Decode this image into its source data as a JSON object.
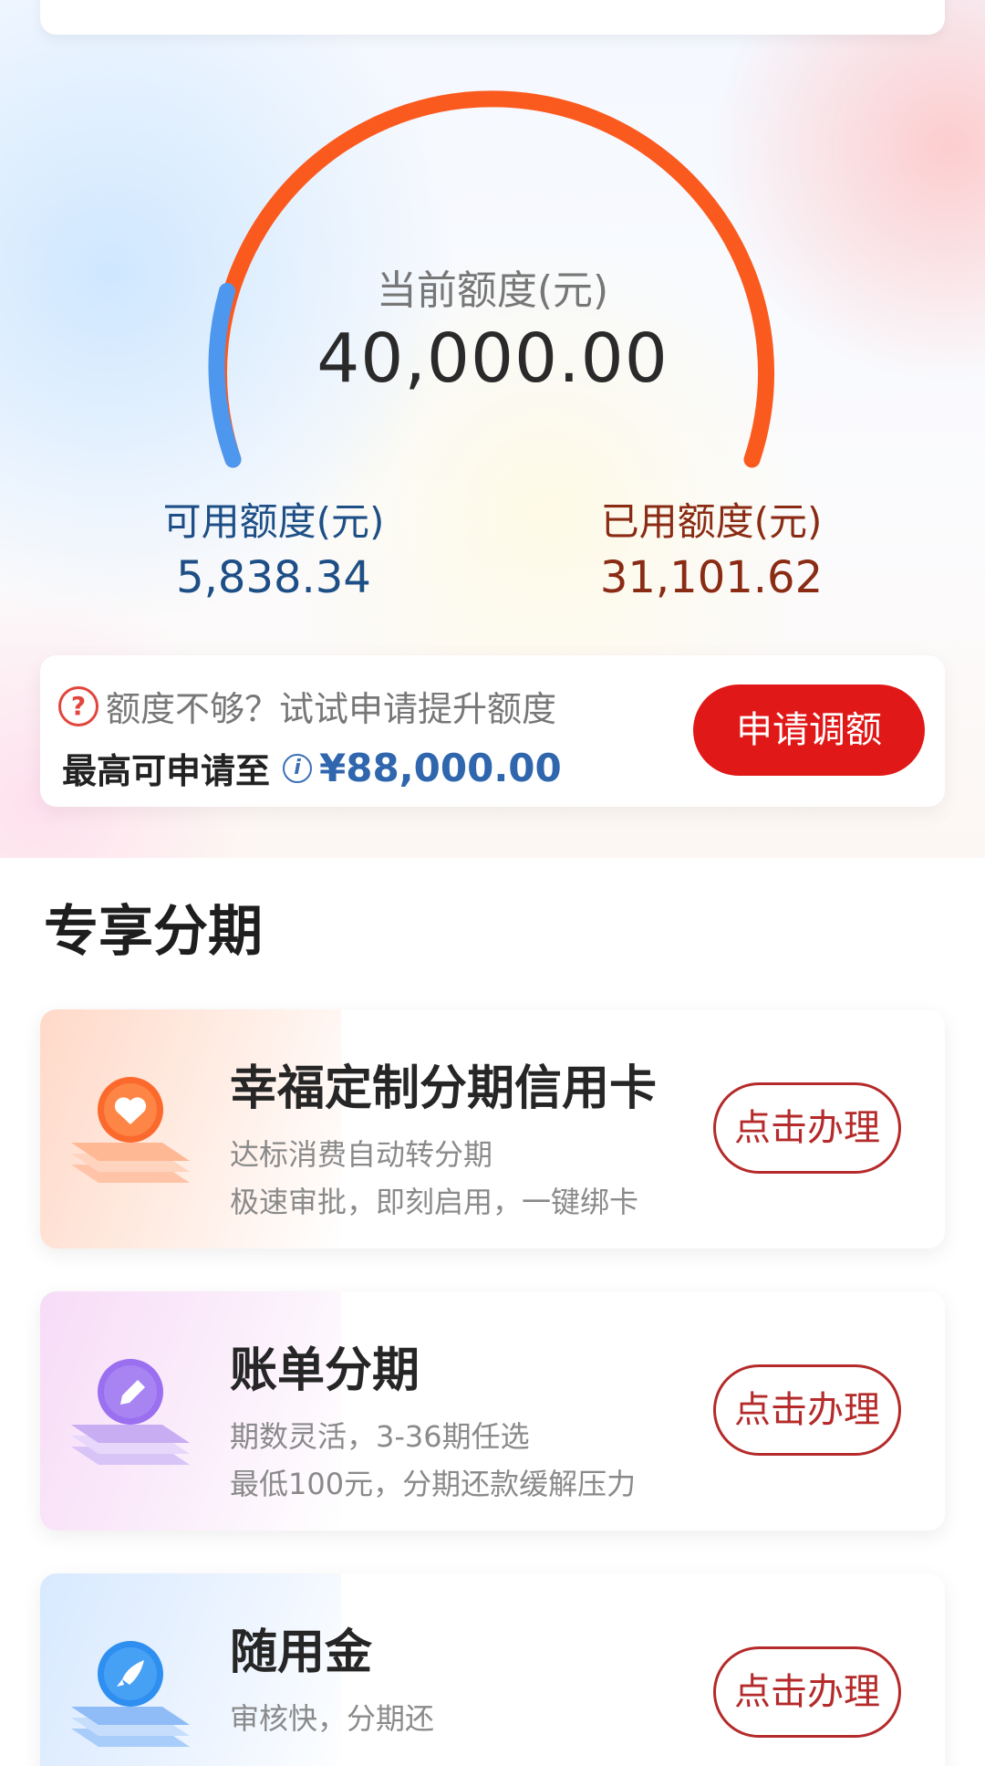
{
  "credit": {
    "current_label": "当前额度(元)",
    "current_value": "40,000.00",
    "available_label": "可用额度(元)",
    "available_value": "5,838.34",
    "used_label": "已用额度(元)",
    "used_value": "31,101.62",
    "available_fraction": 0.146,
    "colors": {
      "available": "#4d97ee",
      "used": "#fb5a1f"
    }
  },
  "raise": {
    "question": "额度不够？试试申请提升额度",
    "max_label": "最高可申请至",
    "max_value": "¥88,000.00",
    "button_label": "申请调额",
    "question_icon": "question-circle-icon",
    "info_icon": "info-circle-icon"
  },
  "section": {
    "title": "专享分期"
  },
  "products": [
    {
      "name": "幸福定制分期信用卡",
      "line1": "达标消费自动转分期",
      "line2": "极速审批，即刻启用，一键绑卡",
      "button": "点击办理",
      "icon": "heart-icon"
    },
    {
      "name": "账单分期",
      "line1": "期数灵活，3-36期任选",
      "line2": "最低100元，分期还款缓解压力",
      "button": "点击办理",
      "icon": "pencil-icon"
    },
    {
      "name": "随用金",
      "line1": "审核快，分期还",
      "button": "点击办理",
      "icon": "rocket-icon"
    }
  ]
}
